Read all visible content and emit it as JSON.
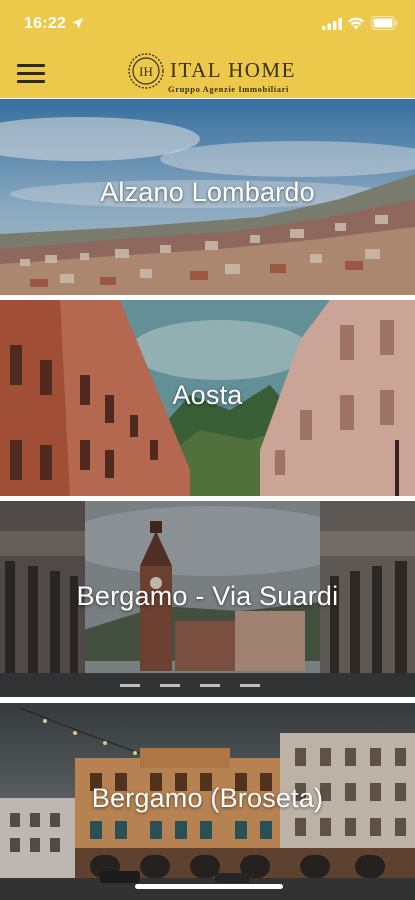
{
  "status_bar": {
    "time": "16:22",
    "icons": [
      "location-arrow-icon",
      "signal-icon",
      "wifi-icon",
      "battery-icon"
    ]
  },
  "header": {
    "menu_icon": "hamburger-menu-icon",
    "logo_monogram": "IH",
    "logo_text": "ITAL HOME",
    "logo_subtitle": "Gruppo Agenzie Immobiliari",
    "background_color": "#ecc94b"
  },
  "agencies": [
    {
      "name": "Alzano Lombardo"
    },
    {
      "name": "Aosta"
    },
    {
      "name": "Bergamo - Via Suardi"
    },
    {
      "name": "Bergamo (Broseta)"
    }
  ]
}
